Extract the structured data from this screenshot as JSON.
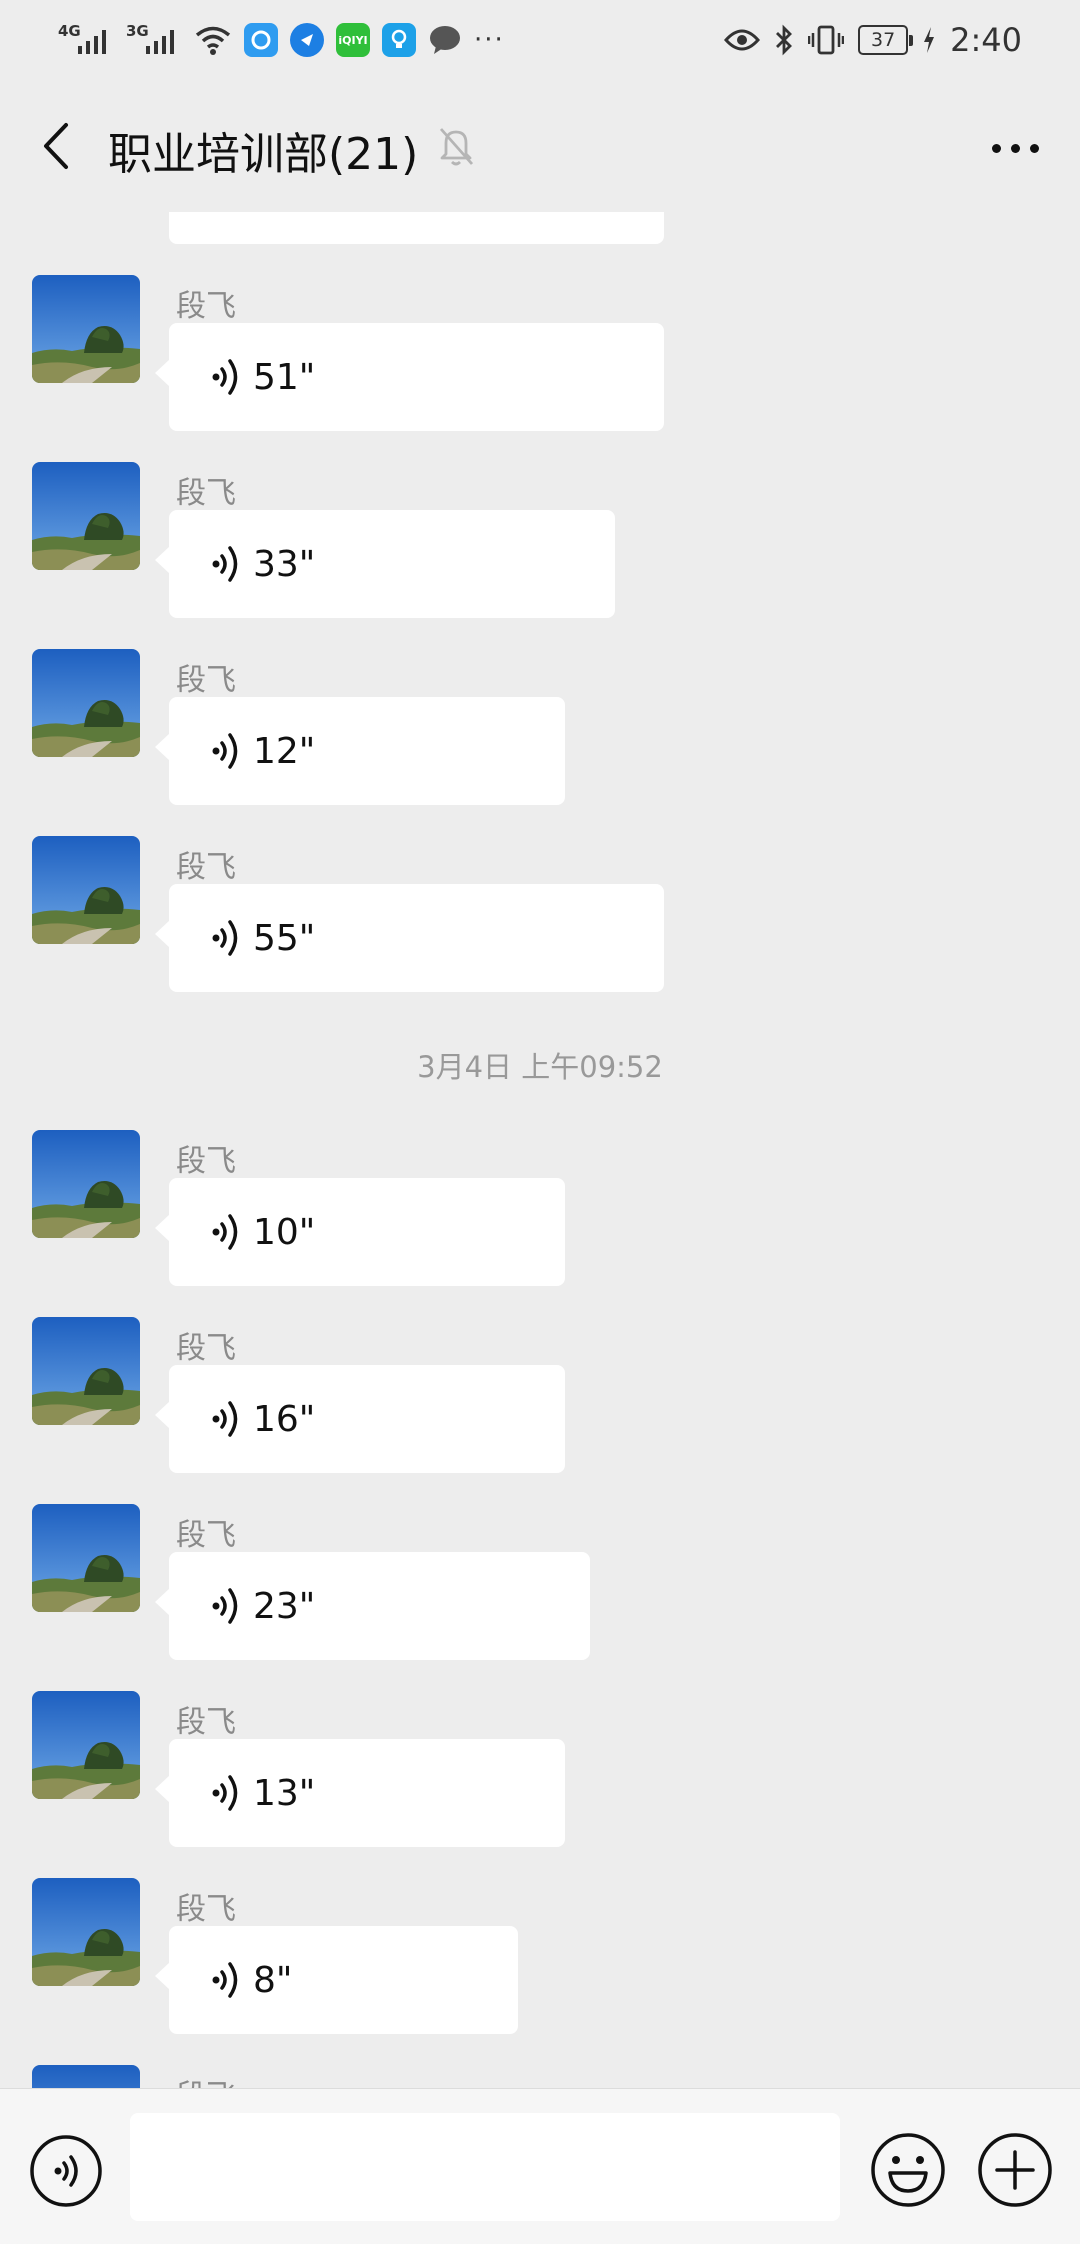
{
  "status_bar": {
    "signal1_label": "4G",
    "signal2_label": "3G",
    "app_icon_iqiyi": "iQIYI",
    "overflow_dots": "···",
    "battery": "37",
    "time": "2:40"
  },
  "header": {
    "title": "职业培训部(21)"
  },
  "messages": [
    {
      "sender": "段飞",
      "duration": "51\""
    },
    {
      "sender": "段飞",
      "duration": "33\""
    },
    {
      "sender": "段飞",
      "duration": "12\""
    },
    {
      "sender": "段飞",
      "duration": "55\""
    },
    {
      "sender": "段飞",
      "duration": "10\""
    },
    {
      "sender": "段飞",
      "duration": "16\""
    },
    {
      "sender": "段飞",
      "duration": "23\""
    },
    {
      "sender": "段飞",
      "duration": "13\""
    },
    {
      "sender": "段飞",
      "duration": "8\""
    },
    {
      "sender": "段飞",
      "duration": ""
    }
  ],
  "timestamp": "3月4日 上午09:52",
  "input_bar": {
    "placeholder": ""
  },
  "colors": {
    "background": "#ededed",
    "bubble": "#ffffff",
    "sender_text": "#8a8a8a",
    "timestamp_text": "#999999"
  },
  "icons": [
    "back-arrow-icon",
    "mute-bell-icon",
    "more-dots-icon",
    "voice-wave-icon",
    "emoji-icon",
    "plus-icon"
  ]
}
